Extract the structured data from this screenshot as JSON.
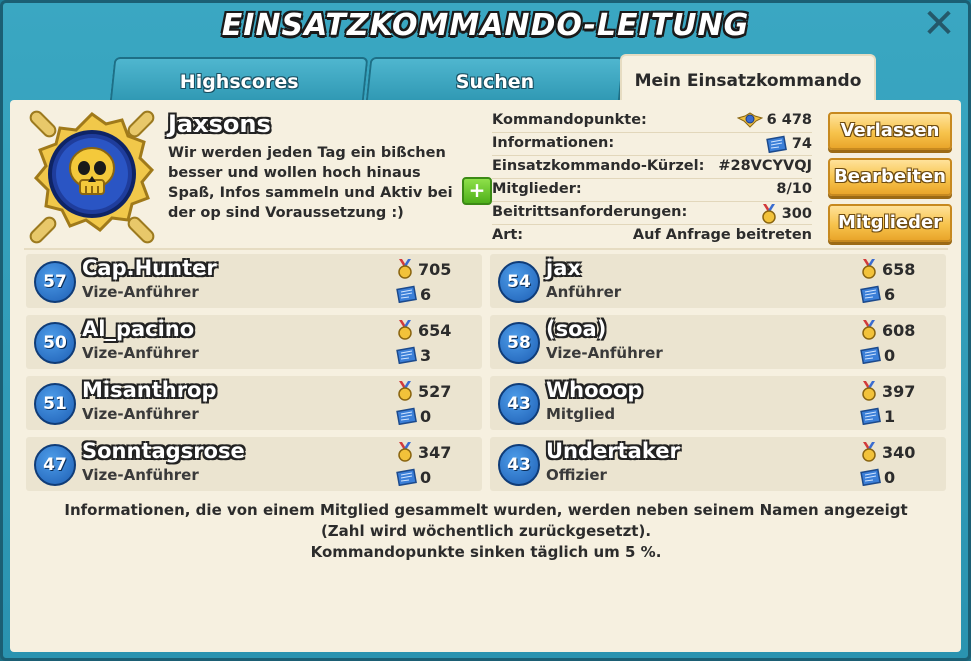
{
  "window": {
    "title": "EINSATZKOMMANDO-LEITUNG"
  },
  "tabs": [
    {
      "label": "Highscores"
    },
    {
      "label": "Suchen"
    },
    {
      "label": "Mein Einsatzkommando"
    }
  ],
  "clan": {
    "name": "Jaxsons",
    "description": "Wir werden jeden Tag ein bißchen besser und wollen hoch hinaus Spaß, Infos sammeln und Aktiv bei der op sind Voraussetzung :)",
    "info": [
      {
        "label": "Kommandopunkte:",
        "value": "6 478",
        "icon": "task-force-points-icon"
      },
      {
        "label": "Informationen:",
        "value": "74",
        "icon": "intel-icon"
      },
      {
        "label": "Einsatzkommando-Kürzel:",
        "value": "#28VCYVQJ",
        "icon": ""
      },
      {
        "label": "Mitglieder:",
        "value": "8/10",
        "icon": ""
      },
      {
        "label": "Beitrittsanforderungen:",
        "value": "300",
        "icon": "medal-icon"
      },
      {
        "label": "Art:",
        "value": "Auf Anfrage beitreten",
        "icon": ""
      }
    ]
  },
  "buttons": {
    "leave": "Verlassen",
    "edit": "Bearbeiten",
    "members": "Mitglieder",
    "plus": "+"
  },
  "members": [
    {
      "level": "57",
      "name": "Cap.Hunter",
      "role": "Vize-Anführer",
      "medals": "705",
      "intel": "6"
    },
    {
      "level": "54",
      "name": "jax",
      "role": "Anführer",
      "medals": "658",
      "intel": "6"
    },
    {
      "level": "50",
      "name": "Al_pacino",
      "role": "Vize-Anführer",
      "medals": "654",
      "intel": "3"
    },
    {
      "level": "58",
      "name": "(soa)",
      "role": "Vize-Anführer",
      "medals": "608",
      "intel": "0"
    },
    {
      "level": "51",
      "name": "Misanthrop",
      "role": "Vize-Anführer",
      "medals": "527",
      "intel": "0"
    },
    {
      "level": "43",
      "name": "Whooop",
      "role": "Mitglied",
      "medals": "397",
      "intel": "1"
    },
    {
      "level": "47",
      "name": "Sonntagsrose",
      "role": "Vize-Anführer",
      "medals": "347",
      "intel": "0"
    },
    {
      "level": "43",
      "name": "Undertaker",
      "role": "Offizier",
      "medals": "340",
      "intel": "0"
    }
  ],
  "footer": {
    "line1": "Informationen, die von einem Mitglied gesammelt wurden, werden neben seinem Namen angezeigt",
    "line2": "(Zahl wird wöchentlich zurückgesetzt).",
    "line3": "Kommandopunkte sinken täglich um 5 %."
  },
  "colors": {
    "panel": "#f6f0e0",
    "frame": "#2a93b0",
    "button": "#f7c34c",
    "level_badge": "#1e5fb5"
  }
}
